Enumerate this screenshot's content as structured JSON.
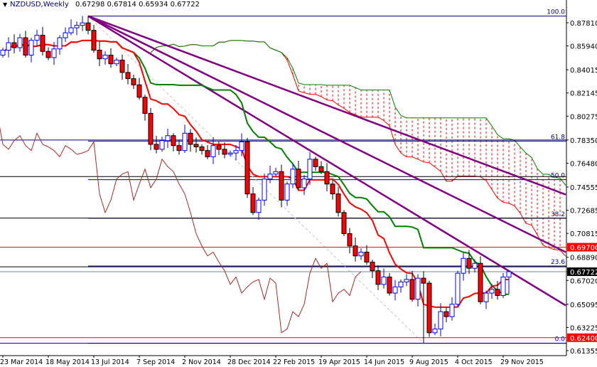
{
  "header": {
    "symbol": "NZDUSD,Weekly",
    "ohlc": "0.67298 0.67814 0.65934 0.67722"
  },
  "chart_data": {
    "type": "candlestick",
    "symbol": "NZDUSD",
    "timeframe": "Weekly",
    "last_bar": {
      "open": 0.67298,
      "high": 0.67814,
      "low": 0.65934,
      "close": 0.67722
    },
    "closes": [
      0.856,
      0.862,
      0.858,
      0.866,
      0.852,
      0.864,
      0.868,
      0.855,
      0.85,
      0.857,
      0.866,
      0.87,
      0.874,
      0.876,
      0.878,
      0.872,
      0.856,
      0.849,
      0.852,
      0.845,
      0.848,
      0.838,
      0.833,
      0.828,
      0.818,
      0.805,
      0.78,
      0.776,
      0.783,
      0.787,
      0.779,
      0.775,
      0.789,
      0.78,
      0.778,
      0.775,
      0.77,
      0.779,
      0.776,
      0.772,
      0.773,
      0.775,
      0.782,
      0.74,
      0.725,
      0.735,
      0.752,
      0.756,
      0.758,
      0.735,
      0.748,
      0.76,
      0.745,
      0.752,
      0.768,
      0.762,
      0.758,
      0.748,
      0.74,
      0.725,
      0.708,
      0.698,
      0.69,
      0.693,
      0.685,
      0.678,
      0.667,
      0.673,
      0.66,
      0.665,
      0.669,
      0.671,
      0.655,
      0.672,
      0.668,
      0.628,
      0.631,
      0.645,
      0.641,
      0.651,
      0.676,
      0.688,
      0.68,
      0.684,
      0.653,
      0.66,
      0.663,
      0.658,
      0.67298,
      0.67722
    ],
    "x_tick_labels": [
      "23 Mar 2014",
      "18 May 2014",
      "13 Jul 2014",
      "7 Sep 2014",
      "2 Nov 2014",
      "28 Dec 2014",
      "22 Feb 2015",
      "19 Apr 2015",
      "14 Jun 2015",
      "9 Aug 2015",
      "4 Oct 2015",
      "29 Nov 2015"
    ],
    "x_tick_every_bars": 8,
    "y_tick_labels": [
      "0.87810",
      "0.85940",
      "0.84015",
      "0.82145",
      "0.80275",
      "0.78350",
      "0.76480",
      "0.74555",
      "0.72685",
      "0.70815",
      "0.68890",
      "0.67020",
      "0.65095",
      "0.63225",
      "0.61355"
    ],
    "ylim": [
      0.6115,
      0.8895
    ],
    "fibonacci": {
      "high": 0.8835,
      "low": 0.6195,
      "levels": [
        {
          "label": "100.0",
          "ratio": 1.0
        },
        {
          "label": "61.8",
          "ratio": 0.618
        },
        {
          "label": "50.0",
          "ratio": 0.5
        },
        {
          "label": "38.2",
          "ratio": 0.382
        },
        {
          "label": "23.6",
          "ratio": 0.236
        },
        {
          "label": "0.0",
          "ratio": 0.0
        }
      ]
    },
    "horizontal_levels": [
      {
        "price": 0.697,
        "label": "0.69700",
        "color": "#ff0000"
      },
      {
        "price": 0.624,
        "label": "0.62400",
        "color": "#ff0000"
      }
    ],
    "current_price": {
      "price": 0.67722,
      "label": "0.67722"
    },
    "fan_lines": [
      {
        "from_bar": 15,
        "from_price": 0.8835,
        "to_bar": 99,
        "to_price": 0.7395
      },
      {
        "from_bar": 15,
        "from_price": 0.8835,
        "to_bar": 99,
        "to_price": 0.693
      },
      {
        "from_bar": 15,
        "from_price": 0.8835,
        "to_bar": 99,
        "to_price": 0.65
      }
    ],
    "indicator": "Ichimoku (9, 26, 52)",
    "colors": {
      "bull": "#0000ff",
      "bear": "#ff0000",
      "tenkan": "#ff0000",
      "kijun": "#008000",
      "chikou": "#a52a2a",
      "fan": "#800080",
      "fib": "#000080",
      "cloud_up": "#008000",
      "cloud_down": "#ff0000"
    }
  }
}
